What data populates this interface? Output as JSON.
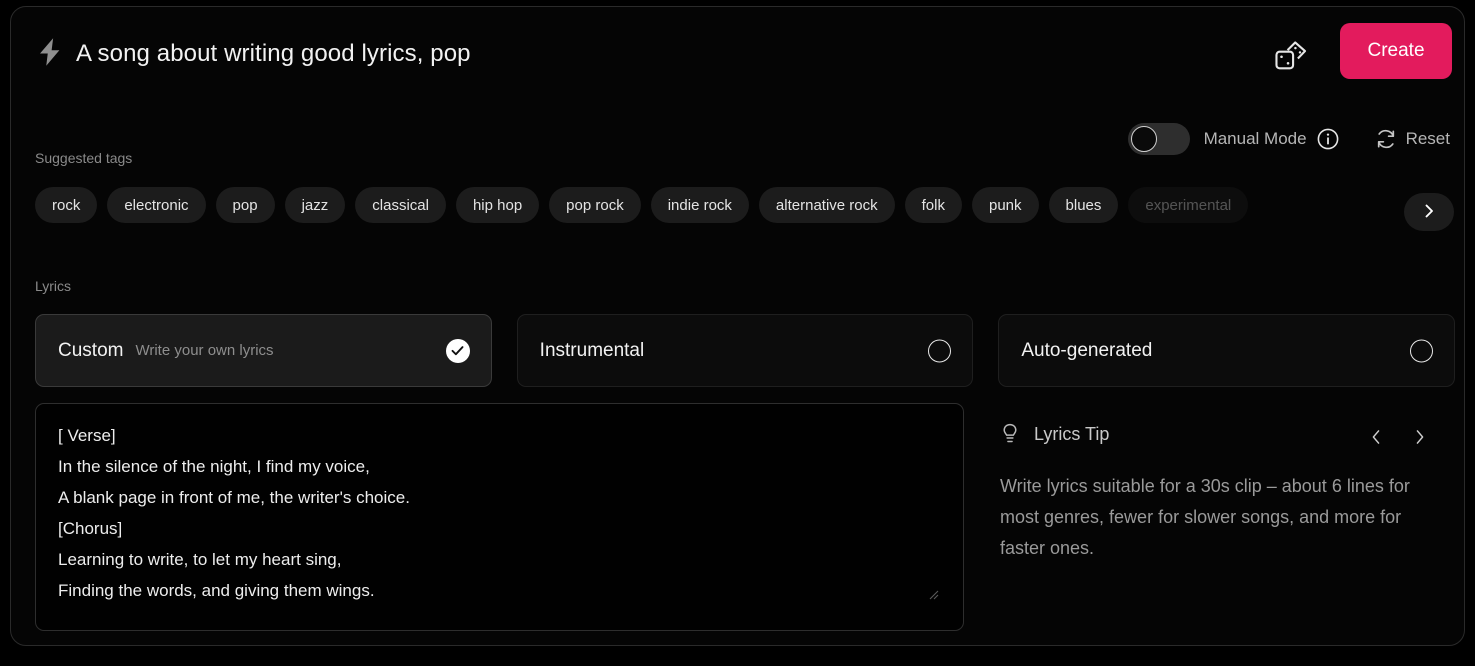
{
  "header": {
    "bolt_icon": "lightning-bolt-icon",
    "prompt_title": "A song about writing good lyrics, pop",
    "dice_icon": "dice-icon",
    "create_label": "Create"
  },
  "mode_row": {
    "toggle_state": "off",
    "manual_mode_label": "Manual Mode",
    "info_icon": "info-icon",
    "reset_icon": "reset-icon",
    "reset_label": "Reset"
  },
  "suggested_tags": {
    "label": "Suggested tags",
    "items": [
      "rock",
      "electronic",
      "pop",
      "jazz",
      "classical",
      "hip hop",
      "pop rock",
      "indie rock",
      "alternative rock",
      "folk",
      "punk",
      "blues",
      "experimental"
    ],
    "scroll_next_icon": "chevron-right-icon"
  },
  "lyrics": {
    "label": "Lyrics",
    "modes": [
      {
        "title": "Custom",
        "subtitle": "Write your own lyrics",
        "selected": true
      },
      {
        "title": "Instrumental",
        "subtitle": "",
        "selected": false
      },
      {
        "title": "Auto-generated",
        "subtitle": "",
        "selected": false
      }
    ],
    "editor_value": "[ Verse]\nIn the silence of the night, I find my voice,\nA blank page in front of me, the writer's choice.\n[Chorus]\nLearning to write, to let my heart sing,\nFinding the words, and giving them wings."
  },
  "lyrics_tip": {
    "bulb_icon": "lightbulb-icon",
    "title": "Lyrics Tip",
    "prev_icon": "chevron-left-icon",
    "next_icon": "chevron-right-icon",
    "body": "Write lyrics suitable for a 30s clip – about 6 lines for most genres, fewer for slower songs, and more for faster ones."
  },
  "colors": {
    "accent": "#e31b5d",
    "background": "#000000",
    "panel": "#050505",
    "tag_bg": "#1c1c1c"
  }
}
